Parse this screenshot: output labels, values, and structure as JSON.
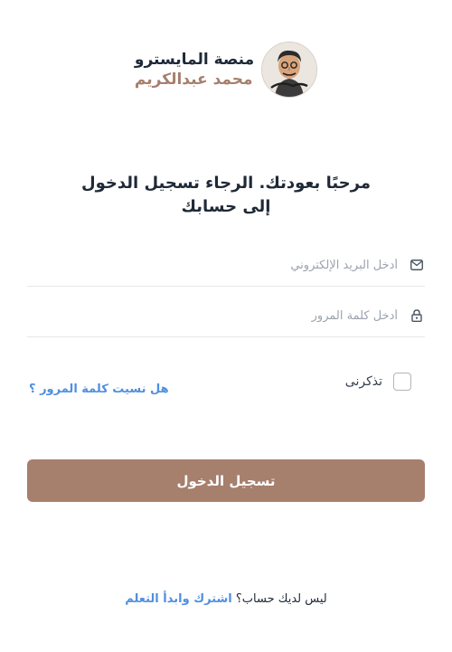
{
  "brand": {
    "title": "منصة المايسترو",
    "subtitle": "محمد عبدالكريم",
    "avatar_icon": "avatar-caricature-icon"
  },
  "welcome": {
    "line1": "مرحبًا بعودتك. الرجاء تسجيل الدخول",
    "line2": "إلى حسابك"
  },
  "form": {
    "email_placeholder": "أدخل البريد الإلكتروني",
    "email_icon": "mail-icon",
    "password_placeholder": "أدخل كلمة المرور",
    "password_icon": "lock-icon",
    "remember_label": "تذكرنى",
    "forgot_label": "هل نسيت كلمة المرور ؟",
    "submit_label": "تسجيل الدخول"
  },
  "signup": {
    "question": "ليس لديك حساب؟",
    "link_label": "اشترك وابدأ التعلم"
  },
  "colors": {
    "accent": "#a67f6d",
    "link": "#4f8fe0",
    "text": "#1f2937"
  }
}
